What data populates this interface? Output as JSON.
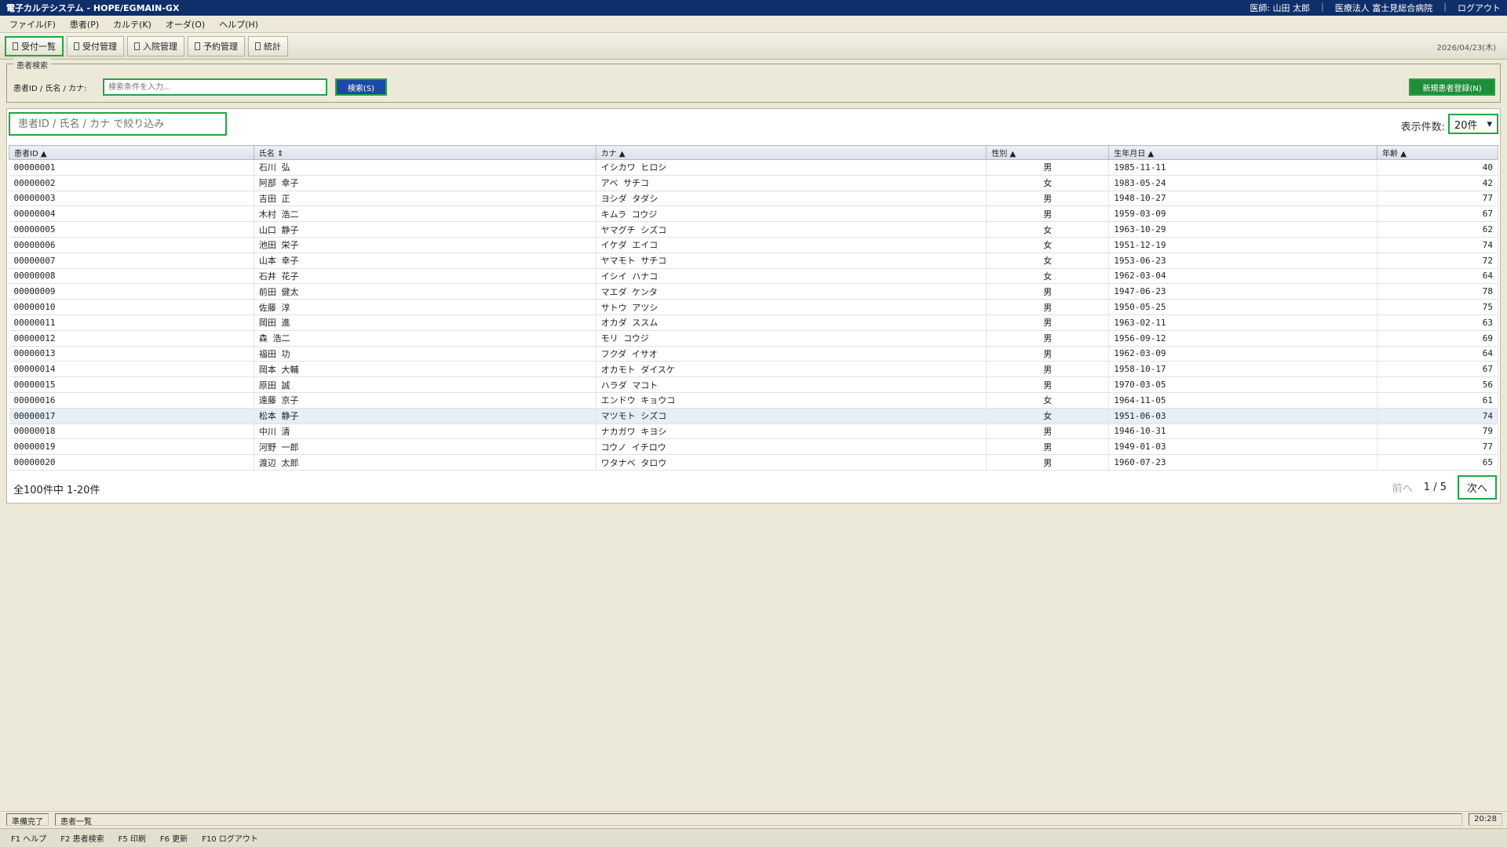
{
  "titlebar": {
    "title": "電子カルテシステム - HOPE/EGMAIN-GX",
    "doctor": "医師: 山田 太郎",
    "hospital": "医療法人 富士見総合病院",
    "logout": "ログアウト"
  },
  "menu": [
    "ファイル(F)",
    "患者(P)",
    "カルテ(K)",
    "オーダ(O)",
    "ヘルプ(H)"
  ],
  "toolbar": {
    "buttons": [
      "受付一覧",
      "受付管理",
      "入院管理",
      "予約管理",
      "統計"
    ],
    "date": "2026/04/23(木)"
  },
  "search": {
    "legend": "患者検索",
    "label": "患者ID / 氏名 / カナ:",
    "placeholder": "検索条件を入力...",
    "search_button": "検索(S)",
    "new_patient_button": "新規患者登録(N)"
  },
  "list": {
    "filter_placeholder": "患者ID / 氏名 / カナ で絞り込み",
    "page_size_label": "表示件数:",
    "page_size": "20件",
    "columns": [
      "患者ID ▲",
      "氏名 ⇕",
      "カナ ▲",
      "性別 ▲",
      "生年月日 ▲",
      "年齢 ▲"
    ],
    "rows": [
      [
        "00000001",
        "石川 弘",
        "イシカワ ヒロシ",
        "男",
        "1985-11-11",
        "40"
      ],
      [
        "00000002",
        "阿部 幸子",
        "アベ サチコ",
        "女",
        "1983-05-24",
        "42"
      ],
      [
        "00000003",
        "吉田 正",
        "ヨシダ タダシ",
        "男",
        "1948-10-27",
        "77"
      ],
      [
        "00000004",
        "木村 浩二",
        "キムラ コウジ",
        "男",
        "1959-03-09",
        "67"
      ],
      [
        "00000005",
        "山口 静子",
        "ヤマグチ シズコ",
        "女",
        "1963-10-29",
        "62"
      ],
      [
        "00000006",
        "池田 栄子",
        "イケダ エイコ",
        "女",
        "1951-12-19",
        "74"
      ],
      [
        "00000007",
        "山本 幸子",
        "ヤマモト サチコ",
        "女",
        "1953-06-23",
        "72"
      ],
      [
        "00000008",
        "石井 花子",
        "イシイ ハナコ",
        "女",
        "1962-03-04",
        "64"
      ],
      [
        "00000009",
        "前田 健太",
        "マエダ ケンタ",
        "男",
        "1947-06-23",
        "78"
      ],
      [
        "00000010",
        "佐藤 淳",
        "サトウ アツシ",
        "男",
        "1950-05-25",
        "75"
      ],
      [
        "00000011",
        "岡田 進",
        "オカダ ススム",
        "男",
        "1963-02-11",
        "63"
      ],
      [
        "00000012",
        "森 浩二",
        "モリ コウジ",
        "男",
        "1956-09-12",
        "69"
      ],
      [
        "00000013",
        "福田 功",
        "フクダ イサオ",
        "男",
        "1962-03-09",
        "64"
      ],
      [
        "00000014",
        "岡本 大輔",
        "オカモト ダイスケ",
        "男",
        "1958-10-17",
        "67"
      ],
      [
        "00000015",
        "原田 誠",
        "ハラダ マコト",
        "男",
        "1970-03-05",
        "56"
      ],
      [
        "00000016",
        "遠藤 京子",
        "エンドウ キョウコ",
        "女",
        "1964-11-05",
        "61"
      ],
      [
        "00000017",
        "松本 静子",
        "マツモト シズコ",
        "女",
        "1951-06-03",
        "74"
      ],
      [
        "00000018",
        "中川 清",
        "ナカガワ キヨシ",
        "男",
        "1946-10-31",
        "79"
      ],
      [
        "00000019",
        "河野 一郎",
        "コウノ イチロウ",
        "男",
        "1949-01-03",
        "77"
      ],
      [
        "00000020",
        "渡辺 太郎",
        "ワタナベ タロウ",
        "男",
        "1960-07-23",
        "65"
      ]
    ],
    "selected_row": 16,
    "total": "全100件中 1-20件",
    "prev": "前へ",
    "page": "1 / 5",
    "next": "次へ"
  },
  "status": {
    "state": "準備完了",
    "screen": "患者一覧",
    "time": "20:28"
  },
  "fkeys": [
    "F1 ヘルプ",
    "F2 患者検索",
    "F5 印刷",
    "F6 更新",
    "F10 ログアウト"
  ]
}
